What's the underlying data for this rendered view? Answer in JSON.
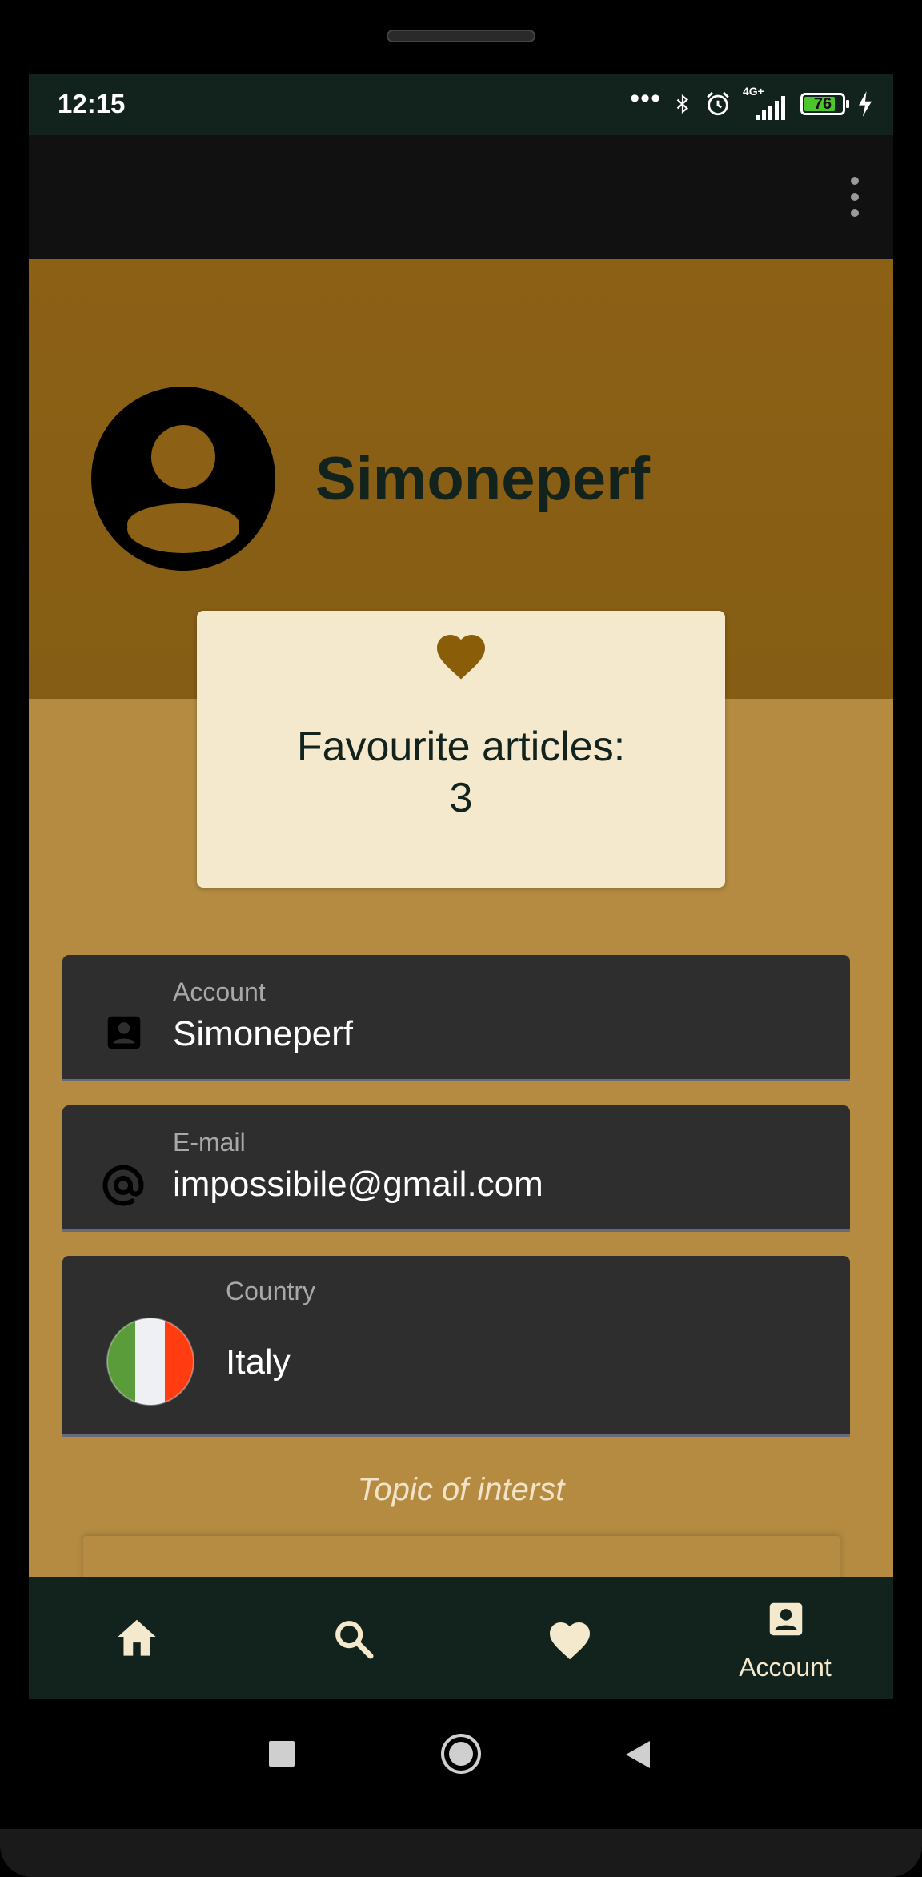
{
  "status_bar": {
    "time": "12:15",
    "network": "4G+",
    "battery_level": "76",
    "icons": [
      "dots-icon",
      "bluetooth-icon",
      "alarm-icon",
      "signal-icon",
      "battery-icon",
      "charging-icon"
    ]
  },
  "app_bar": {
    "menu_icon": "more-vert-icon"
  },
  "profile": {
    "username": "Simoneperf",
    "avatar_icon": "account-circle-icon"
  },
  "favourites": {
    "label": "Favourite articles:",
    "count": "3",
    "icon": "heart-icon"
  },
  "fields": {
    "account": {
      "label": "Account",
      "value": "Simoneperf",
      "icon": "account-box-icon"
    },
    "email": {
      "label": "E-mail",
      "value": "impossibile@gmail.com",
      "icon": "at-sign-icon"
    },
    "country": {
      "label": "Country",
      "value": "Italy",
      "icon": "italy-flag-icon"
    }
  },
  "topics": {
    "title": "Topic of interst"
  },
  "bottom_nav": {
    "items": [
      {
        "icon": "home-icon",
        "label": ""
      },
      {
        "icon": "search-icon",
        "label": ""
      },
      {
        "icon": "heart-icon",
        "label": ""
      },
      {
        "icon": "account-box-icon",
        "label": "Account"
      }
    ],
    "active_index": 3
  },
  "colors": {
    "primary_dark": "#12221c",
    "header_brown": "#8c6116",
    "background_tan": "#b48b41",
    "card_cream": "#f4e9cd",
    "field_dark": "#2e2e2e"
  }
}
